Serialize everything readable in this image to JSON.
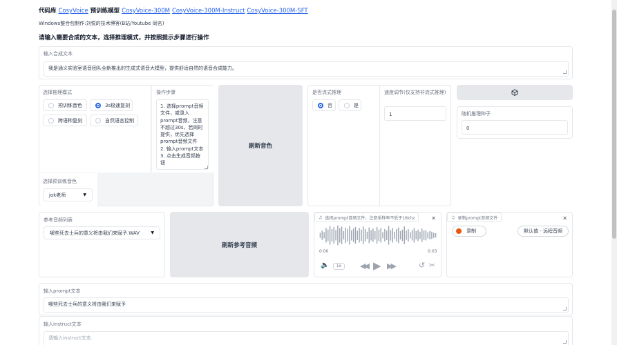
{
  "header": {
    "repo_prefix": "代码库",
    "repo_link": "CosyVoice",
    "models_prefix": "预训练模型",
    "model_links": [
      "CosyVoice-300M",
      "CosyVoice-300M-Instruct",
      "CosyVoice-300M-SFT"
    ],
    "credits": "Windows整合包制作:刘悦的技术博客(B站/Youtube 同名)",
    "instruction": "请输入需要合成的文本，选择推理模式，并按照提示步骤进行操作"
  },
  "synth_text": {
    "label": "输入合成文本",
    "value": "我是通义实验室语音团队全新推出的生成式语音大模型，提供舒适自然的语音合成能力。"
  },
  "mode": {
    "label": "选择推理模式",
    "options": [
      "预训练音色",
      "3s极速复刻",
      "跨语种复刻",
      "自然语言控制"
    ],
    "selected": "3s极速复刻"
  },
  "steps": {
    "label": "操作步骤",
    "text": "1. 选择prompt音频文件，或录入prompt音频，注意不超过30s，若同时提供，优先选择prompt音频文件\n2. 输入prompt文本\n3. 点击生成音频按钮"
  },
  "refresh_voice_button": "刷新音色",
  "stream": {
    "label": "是否流式推理",
    "options": [
      "否",
      "是"
    ],
    "selected": "否"
  },
  "speed": {
    "label": "速度调节(仅支持非流式推理)",
    "value": "1"
  },
  "dice_icon": "dice-icon",
  "seed": {
    "label": "随机推理种子",
    "value": "0"
  },
  "pretrained_voice": {
    "label": "选择预训练音色",
    "value": "jok老师"
  },
  "ref_audio": {
    "label": "参考音频列表",
    "value": "哪些死去士兵的意义将由我们来赋予.WAV"
  },
  "refresh_ref_button": "刷新参考音频",
  "audio_file": {
    "label": "选择prompt音频文件，注意采样率不低于16khz",
    "time_start": "0:00",
    "time_end": "0:03",
    "speed": "1x",
    "waveform": [
      0.25,
      0.45,
      0.3,
      0.7,
      0.55,
      0.9,
      0.6,
      0.8,
      0.5,
      0.95,
      0.7,
      0.85,
      0.4,
      0.75,
      0.6,
      0.9,
      0.5,
      0.65,
      0.8,
      0.45,
      0.7,
      0.55,
      0.85,
      0.6,
      0.35,
      0.75,
      0.5,
      0.65,
      0.4,
      0.8,
      0.55,
      0.7,
      0.3,
      0.6,
      0.45,
      0.9,
      0.5,
      0.7,
      0.35,
      0.6,
      0.75,
      0.4,
      0.55,
      0.85,
      0.45,
      0.6,
      0.3,
      0.5,
      0.7,
      0.4,
      0.55,
      0.35,
      0.65,
      0.45,
      0.5,
      0.3,
      0.4,
      0.35,
      0.25,
      0.2
    ]
  },
  "record": {
    "label": "录制prompt音频文件",
    "record_button": "录制",
    "source_button": "默认值 - 远程音频"
  },
  "prompt_text": {
    "label": "输入prompt文本",
    "value": "哪些死去士兵的意义将由我们来赋予"
  },
  "instruct_text": {
    "label": "输入instruct文本",
    "placeholder": "请输入instruct文本."
  },
  "colors": {
    "accent": "#2563eb",
    "button_bg": "#e5e7eb",
    "record_dot": "#ea580c"
  }
}
